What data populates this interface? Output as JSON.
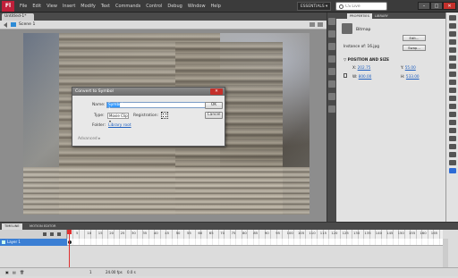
{
  "app": {
    "logo": "Fl"
  },
  "menu": [
    "File",
    "Edit",
    "View",
    "Insert",
    "Modify",
    "Text",
    "Commands",
    "Control",
    "Debug",
    "Window",
    "Help"
  ],
  "workspace": "ESSENTIALS ▾",
  "search": {
    "placeholder": "CS Live"
  },
  "window_buttons": {
    "minimize": "–",
    "maximize": "□",
    "close": "✕"
  },
  "document": {
    "tab": "Untitled-1*",
    "scene": "Scene 1"
  },
  "dialog": {
    "title": "Convert to Symbol",
    "close": "✕",
    "name_label": "Name:",
    "name_value": "Symbol 1",
    "type_label": "Type:",
    "type_value": "Movie Clip ▾",
    "registration_label": "Registration:",
    "folder_label": "Folder:",
    "folder_value": "Library root",
    "advanced": "Advanced ▸",
    "ok": "OK",
    "cancel": "Cancel"
  },
  "properties": {
    "tabs": [
      "PROPERTIES",
      "LIBRARY"
    ],
    "kind": "Bitmap",
    "edit": "Edit...",
    "instance_of_label": "Instance of:",
    "instance_of_value": "16.jpg",
    "swap": "Swap...",
    "section": "▽ POSITION AND SIZE",
    "x_label": "X:",
    "x_value": "202.75",
    "y_label": "Y:",
    "y_value": "55.00",
    "w_label": "W:",
    "w_value": "800.00",
    "h_label": "H:",
    "h_value": "533.00"
  },
  "timeline": {
    "tabs": [
      "TIMELINE",
      "MOTION EDITOR"
    ],
    "layer": "Layer 1",
    "frame_ticks": [
      "5",
      "10",
      "15",
      "20",
      "25",
      "30",
      "35",
      "40",
      "45",
      "50",
      "55",
      "60",
      "65",
      "70",
      "75",
      "80",
      "85",
      "90",
      "95",
      "100",
      "105",
      "110",
      "115",
      "120",
      "125",
      "130",
      "135",
      "140",
      "145",
      "150",
      "155",
      "160",
      "165"
    ],
    "status": {
      "frame": "1",
      "fps": "24.00 fps",
      "time": "0.0 s"
    }
  }
}
